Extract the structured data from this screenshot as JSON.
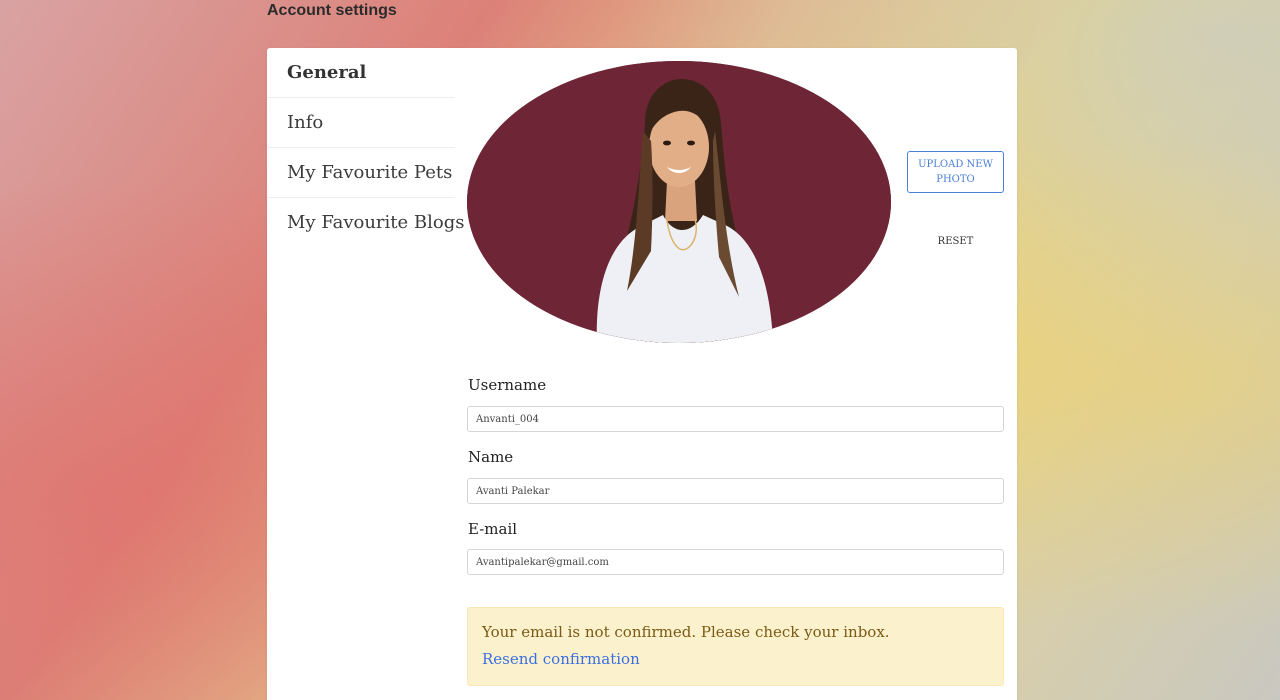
{
  "page": {
    "title": "Account settings"
  },
  "sidebar": {
    "items": [
      {
        "label": "General",
        "active": true
      },
      {
        "label": "Info",
        "active": false
      },
      {
        "label": "My Favourite Pets",
        "active": false
      },
      {
        "label": "My Favourite Blogs",
        "active": false
      }
    ]
  },
  "photo": {
    "upload_label": "UPLOAD NEW PHOTO",
    "reset_label": "RESET"
  },
  "form": {
    "username": {
      "label": "Username",
      "value": "Anvanti_004"
    },
    "name": {
      "label": "Name",
      "value": "Avanti Palekar"
    },
    "email": {
      "label": "E-mail",
      "value": "Avantipalekar@gmail.com"
    }
  },
  "alert": {
    "message": "Your email is not confirmed. Please check your inbox.",
    "link_label": "Resend confirmation"
  },
  "colors": {
    "accent": "#4a7fd6",
    "alert_bg": "#fcf1cd",
    "alert_text": "#7a5a14",
    "link": "#3b6fe0",
    "avatar_bg": "#6e2636"
  }
}
